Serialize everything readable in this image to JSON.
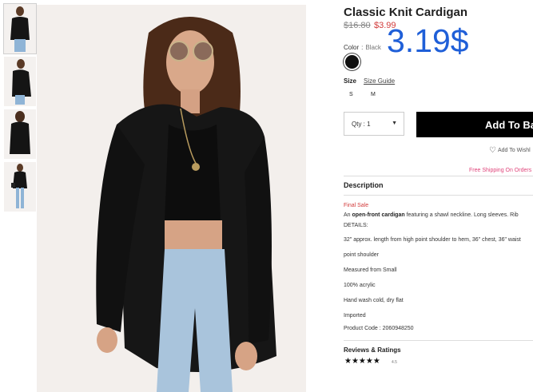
{
  "product": {
    "title": "Classic Knit Cardigan",
    "old_price": "$16.80",
    "sale_price": "$3.99",
    "overlay_price": "3.19$"
  },
  "color": {
    "label": "Color",
    "separator": ":",
    "value": "Black",
    "swatch_hex": "#111111"
  },
  "size": {
    "label": "Size",
    "guide_label": "Size Guide",
    "options": [
      "S",
      "M"
    ]
  },
  "qty": {
    "label": "Qty : 1"
  },
  "actions": {
    "add_label": "Add To Ba",
    "wishlist_label": "Add To Wishl",
    "free_shipping": "Free Shipping On Orders"
  },
  "description": {
    "heading": "Description",
    "final_sale": "Final Sale",
    "intro_prefix": "An ",
    "intro_bold": "open-front cardigan",
    "intro_rest": " featuring a shawl neckline. Long sleeves. Rib",
    "details_label": "DETAILS:",
    "lines": [
      "32\" approx. length from high point shoulder to hem, 36\" chest, 36\" waist",
      "point shoulder",
      "Measured from Small",
      "100% acrylic",
      "Hand wash cold, dry flat",
      "Imported",
      "Product Code : 2060948250"
    ]
  },
  "reviews": {
    "heading": "Reviews & Ratings",
    "stars": "★★★★★",
    "score": "4.5"
  }
}
